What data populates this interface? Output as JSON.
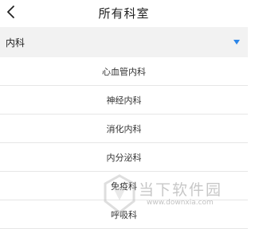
{
  "header": {
    "title": "所有科室",
    "back_icon": "chevron-left-icon"
  },
  "department_select": {
    "value": "内科",
    "caret_icon": "triangle-down-icon",
    "accent_color": "#2c86e8"
  },
  "departments": [
    "心血管内科",
    "神经内科",
    "消化内科",
    "内分泌科",
    "免疫科",
    "呼吸科"
  ],
  "watermark": {
    "text": "当下软件园",
    "url": "www.downxia.com"
  }
}
